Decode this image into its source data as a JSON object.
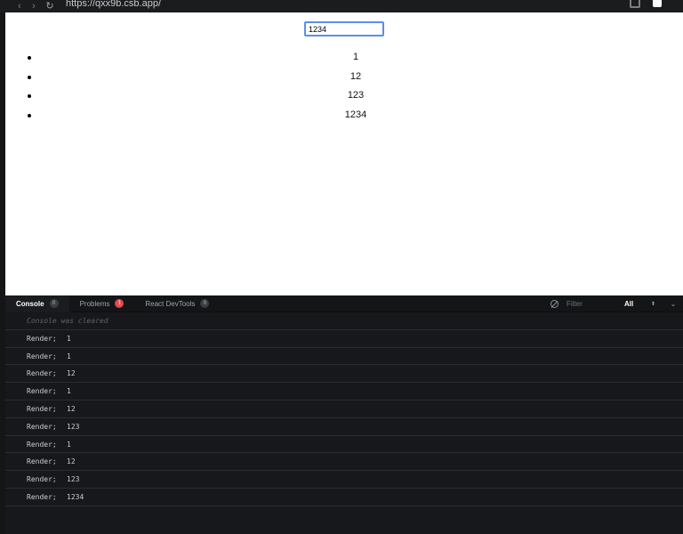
{
  "browser": {
    "url": "https://qxx9b.csb.app/",
    "back_glyph": "‹",
    "forward_glyph": "›",
    "reload_glyph": "↻"
  },
  "preview": {
    "input_value": "1234",
    "items": [
      {
        "text": "1"
      },
      {
        "text": "12"
      },
      {
        "text": "123"
      },
      {
        "text": "1234"
      }
    ]
  },
  "devtools": {
    "tabs": [
      {
        "label": "Console",
        "count": "0",
        "active": true,
        "badge": "normal"
      },
      {
        "label": "Problems",
        "count": "1",
        "active": false,
        "badge": "error"
      },
      {
        "label": "React DevTools",
        "count": "0",
        "active": false,
        "badge": "normal"
      }
    ],
    "filter_placeholder": "Filter",
    "level": "All",
    "updown_glyph": "⬍",
    "chevron_glyph": "⌄"
  },
  "console": {
    "cleared_text": "Console was cleared",
    "lines": [
      {
        "label": "Render;",
        "value": "1"
      },
      {
        "label": "Render;",
        "value": "1"
      },
      {
        "label": "Render;",
        "value": "12"
      },
      {
        "label": "Render;",
        "value": "1"
      },
      {
        "label": "Render;",
        "value": "12"
      },
      {
        "label": "Render;",
        "value": "123"
      },
      {
        "label": "Render;",
        "value": "1"
      },
      {
        "label": "Render;",
        "value": "12"
      },
      {
        "label": "Render;",
        "value": "123"
      },
      {
        "label": "Render;",
        "value": "1234"
      }
    ]
  },
  "colors": {
    "accent_input_border": "#5b8def",
    "error_badge": "#e5484d",
    "devtools_bg": "#16181b"
  }
}
